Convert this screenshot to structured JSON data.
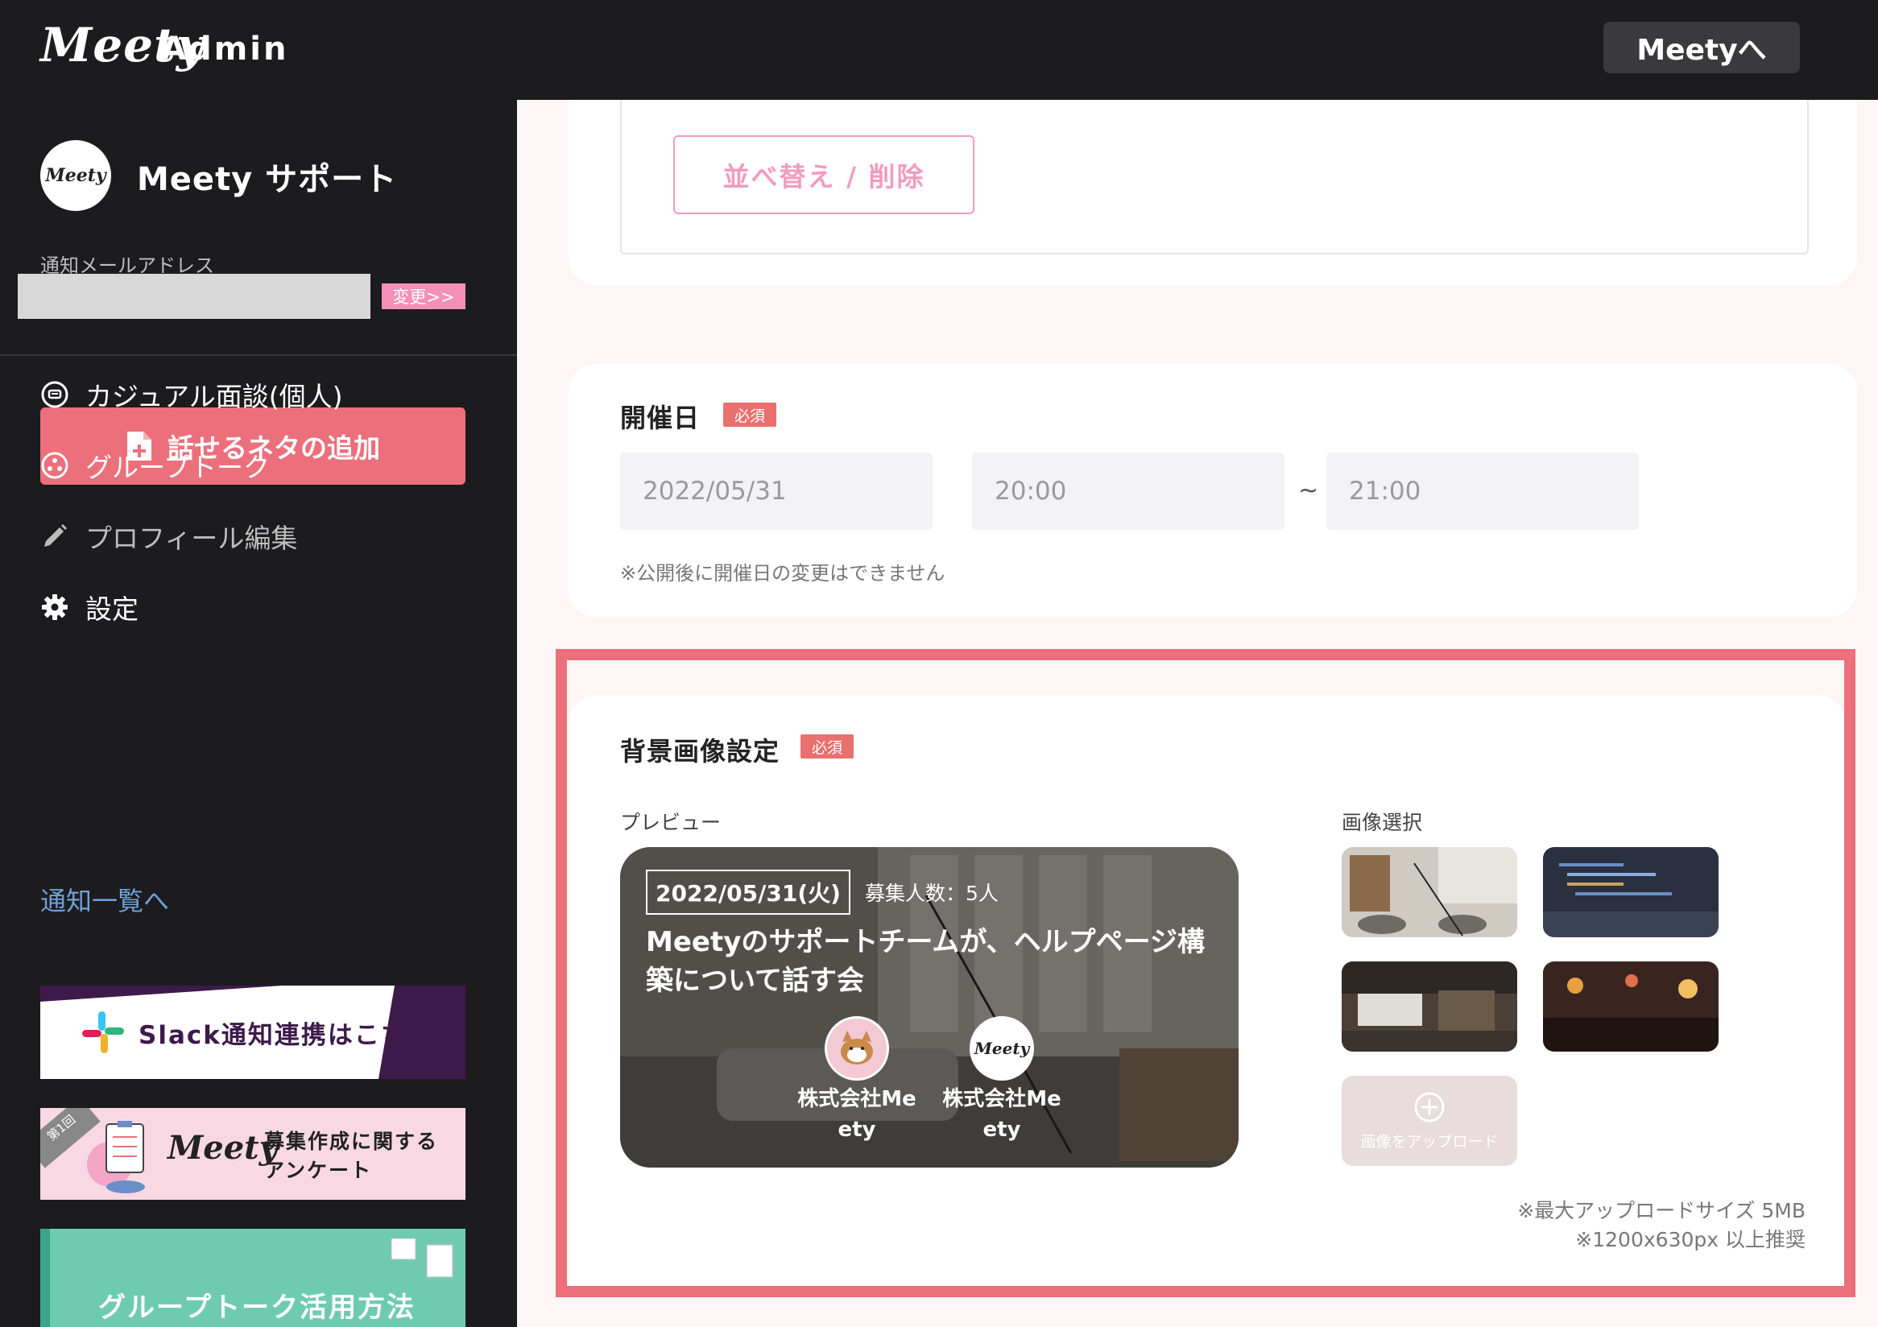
{
  "header": {
    "logo_script": "Meety",
    "logo_admin": "Admin",
    "meety_link": "Meetyへ"
  },
  "sidebar": {
    "avatar_text": "Meety",
    "org_name": "Meety サポート",
    "email_label": "通知メールアドレス",
    "change_label": "変更>>",
    "add_topic_label": "話せるネタの追加",
    "nav": [
      {
        "label": "カジュアル面談(個人)",
        "icon": "chat-icon"
      },
      {
        "label": "グループトーク",
        "icon": "group-icon"
      },
      {
        "label": "プロフィール編集",
        "icon": "pencil-icon"
      },
      {
        "label": "設定",
        "icon": "gear-icon"
      }
    ],
    "notice_link": "通知一覧へ",
    "banners": {
      "slack": "Slack通知連携はこちら",
      "survey_tag": "第1回",
      "survey_logo": "Meety",
      "survey_line1": "募集作成に関する",
      "survey_line2": "アンケート",
      "group": "グループトーク活用方法"
    }
  },
  "main": {
    "sort_button": "並べ替え / 削除",
    "date_section": {
      "title": "開催日",
      "required": "必須",
      "date": "2022/05/31",
      "start_time": "20:00",
      "separator": "~",
      "end_time": "21:00",
      "note": "※公開後に開催日の変更はできません"
    },
    "bg_section": {
      "title": "背景画像設定",
      "required": "必須",
      "preview_label": "プレビュー",
      "select_label": "画像選択",
      "preview": {
        "date": "2022/05/31(火)",
        "count": "募集人数：5人",
        "title": "Meetyのサポートチームが、ヘルプページ構築について話す会",
        "hosts": [
          {
            "name_line1": "株式会社Me",
            "name_line2": "ety"
          },
          {
            "name_line1": "株式会社Me",
            "name_line2": "ety",
            "avatar_text": "Meety"
          }
        ]
      },
      "upload_label": "画像をアップロード",
      "size_note": "※最大アップロードサイズ 5MB",
      "resolution_note": "※1200x630px 以上推奨"
    }
  },
  "colors": {
    "accent": "#ec6f7c",
    "pink": "#f29bbf",
    "dark": "#1c1c1e",
    "link": "#6fa0d8"
  }
}
